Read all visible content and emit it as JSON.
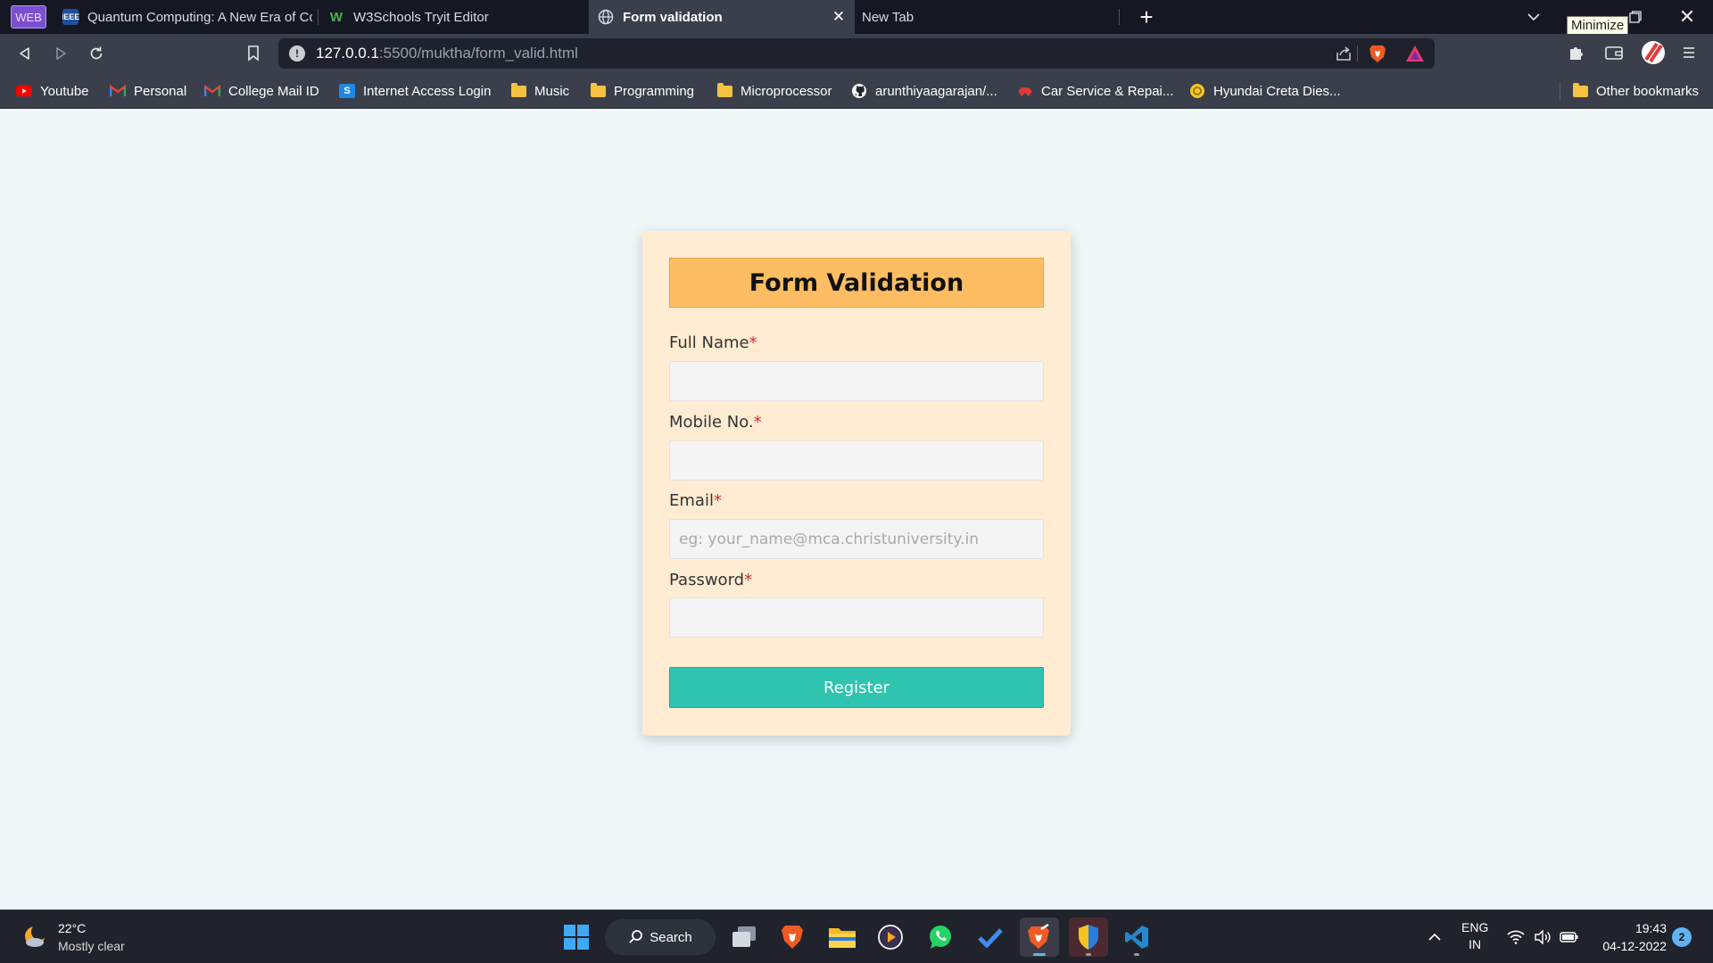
{
  "browser": {
    "tabs": [
      {
        "label": "WEB",
        "type": "pinned"
      },
      {
        "label": "Quantum Computing: A New Era of Co",
        "favicon": "ieee-icon"
      },
      {
        "label": "W3Schools Tryit Editor",
        "favicon": "w3schools-icon"
      },
      {
        "label": "Form validation",
        "favicon": "globe-icon",
        "active": true
      },
      {
        "label": "New Tab"
      }
    ],
    "tooltip": "Minimize",
    "url_host": "127.0.0.1",
    "url_path": ":5500/muktha/form_valid.html",
    "bookmarks": [
      {
        "label": "Youtube",
        "icon": "youtube-icon"
      },
      {
        "label": "Personal",
        "icon": "gmail-icon"
      },
      {
        "label": "College Mail ID",
        "icon": "gmail-icon"
      },
      {
        "label": "Internet Access Login",
        "icon": "s-icon"
      },
      {
        "label": "Music",
        "icon": "folder-icon"
      },
      {
        "label": "Programming",
        "icon": "folder-icon"
      },
      {
        "label": "Microprocessor",
        "icon": "folder-icon"
      },
      {
        "label": "arunthiyaagarajan/...",
        "icon": "github-icon"
      },
      {
        "label": "Car Service & Repai...",
        "icon": "car-icon"
      },
      {
        "label": "Hyundai Creta Dies...",
        "icon": "coin-icon"
      },
      {
        "label": "Other bookmarks",
        "icon": "folder-icon"
      }
    ]
  },
  "form": {
    "title": "Form Validation",
    "required_marker": "*",
    "fields": [
      {
        "label": "Full Name",
        "value": "",
        "placeholder": ""
      },
      {
        "label": "Mobile No.",
        "value": "",
        "placeholder": ""
      },
      {
        "label": "Email",
        "value": "",
        "placeholder": "eg: your_name@mca.christuniversity.in"
      },
      {
        "label": "Password",
        "value": "",
        "placeholder": ""
      }
    ],
    "submit_label": "Register"
  },
  "colors": {
    "card_bg": "#ffecd2",
    "title_bg": "#ffbd63",
    "button_bg": "#2ec4b0",
    "required": "#d92a2a"
  },
  "taskbar": {
    "weather_temp": "22°C",
    "weather_desc": "Mostly clear",
    "search_label": "Search",
    "lang_top": "ENG",
    "lang_bottom": "IN",
    "time": "19:43",
    "date": "04-12-2022",
    "notification_count": "2"
  }
}
